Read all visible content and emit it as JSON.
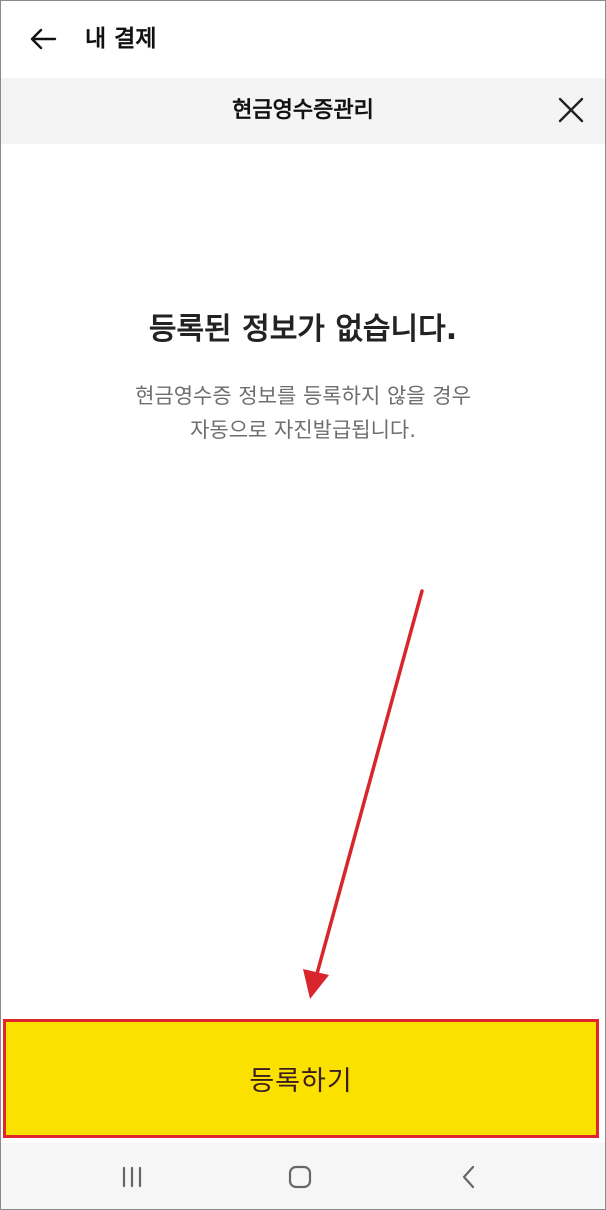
{
  "header": {
    "title": "내 결제",
    "back_icon": "arrow-left-icon"
  },
  "subheader": {
    "title": "현금영수증관리",
    "close_icon": "close-icon"
  },
  "empty_state": {
    "title": "등록된 정보가 없습니다.",
    "description_line1": "현금영수증 정보를 등록하지 않을 경우",
    "description_line2": "자동으로 자진발급됩니다."
  },
  "register_button": {
    "label": "등록하기",
    "background_color": "#fae100",
    "highlight_border_color": "#e0252b"
  },
  "annotation": {
    "arrow_color": "#d9262c"
  },
  "nav_bar": {
    "recents_icon": "recents-icon",
    "home_icon": "home-icon",
    "back_icon": "nav-back-icon"
  }
}
